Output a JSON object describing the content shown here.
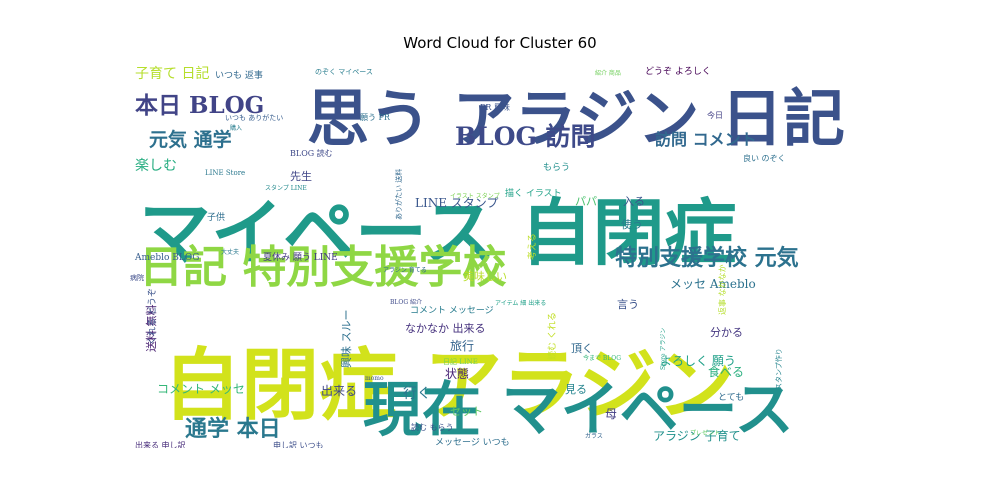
{
  "chart_data": {
    "type": "wordcloud",
    "title": "Word Cloud for Cluster 60",
    "words": [
      {
        "text": "自閉症 アラジン",
        "weight": 100,
        "color": "#d2e21b",
        "rot": 0
      },
      {
        "text": "マイペース 自閉症",
        "weight": 92,
        "color": "#1f9a8a",
        "rot": 0
      },
      {
        "text": "思う アラジン 日記",
        "weight": 80,
        "color": "#3b528b",
        "rot": 0
      },
      {
        "text": "現在 マイペース",
        "weight": 76,
        "color": "#21908d",
        "rot": 0
      },
      {
        "text": "日記 特別支援学校",
        "weight": 56,
        "color": "#8fd744",
        "rot": 0
      },
      {
        "text": "BLOG 訪問",
        "weight": 32,
        "color": "#3e4a89",
        "rot": 0
      },
      {
        "text": "本日 BLOG",
        "weight": 30,
        "color": "#414487",
        "rot": 0
      },
      {
        "text": "特別支援学校 元気",
        "weight": 28,
        "color": "#2c728e",
        "rot": 0
      },
      {
        "text": "通学 本日",
        "weight": 28,
        "color": "#2a788e",
        "rot": 0
      },
      {
        "text": "元気 通学",
        "weight": 24,
        "color": "#2d708e",
        "rot": 0
      },
      {
        "text": "訪問 コメント",
        "weight": 20,
        "color": "#31688e",
        "rot": 0
      },
      {
        "text": "子育て 日記",
        "weight": 18,
        "color": "#b5de2b",
        "rot": 0
      },
      {
        "text": "楽しむ",
        "weight": 18,
        "color": "#27ad81",
        "rot": 0
      },
      {
        "text": "LINE スタンプ",
        "weight": 16,
        "color": "#39568c",
        "rot": 0
      },
      {
        "text": "メッセ Ameblo",
        "weight": 16,
        "color": "#2c728e",
        "rot": 0
      },
      {
        "text": "なかなか 出来る",
        "weight": 14,
        "color": "#46327e",
        "rot": 0
      },
      {
        "text": "コメント メッセ",
        "weight": 16,
        "color": "#35b779",
        "rot": 0
      },
      {
        "text": "アラジン 子育て",
        "weight": 16,
        "color": "#21918c",
        "rot": 0
      },
      {
        "text": "よろしく 願う",
        "weight": 16,
        "color": "#1fa088",
        "rot": 0
      },
      {
        "text": "出来る",
        "weight": 16,
        "color": "#3f4788",
        "rot": 0
      },
      {
        "text": "旅行",
        "weight": 16,
        "color": "#33638d",
        "rot": 0
      },
      {
        "text": "状態",
        "weight": 16,
        "color": "#482576",
        "rot": 0
      },
      {
        "text": "食べる",
        "weight": 16,
        "color": "#29af7f",
        "rot": 0
      },
      {
        "text": "行く",
        "weight": 18,
        "color": "#2a768e",
        "rot": 0
      },
      {
        "text": "見る",
        "weight": 14,
        "color": "#25848e",
        "rot": 0
      },
      {
        "text": "母",
        "weight": 16,
        "color": "#433e85",
        "rot": 0
      },
      {
        "text": "頂く",
        "weight": 14,
        "color": "#31688e",
        "rot": 0
      },
      {
        "text": "分かる",
        "weight": 14,
        "color": "#453781",
        "rot": 0
      },
      {
        "text": "言う",
        "weight": 14,
        "color": "#3b528b",
        "rot": 0
      },
      {
        "text": "使う",
        "weight": 14,
        "color": "#287d8e",
        "rot": 0
      },
      {
        "text": "入る",
        "weight": 14,
        "color": "#3a548c",
        "rot": 0
      },
      {
        "text": "パパ",
        "weight": 14,
        "color": "#4ac16d",
        "rot": 0
      },
      {
        "text": "先生",
        "weight": 14,
        "color": "#404688",
        "rot": 0
      },
      {
        "text": "子供",
        "weight": 12,
        "color": "#2e6e8e",
        "rot": 0
      },
      {
        "text": "美味しい",
        "weight": 14,
        "color": "#b8de29",
        "rot": 0
      },
      {
        "text": "夏休み 願う LINE",
        "weight": 11,
        "color": "#443983",
        "rot": 0
      },
      {
        "text": "Ameblo BLOG",
        "weight": 12,
        "color": "#365d8d",
        "rot": 0
      },
      {
        "text": "メッセージ いつも",
        "weight": 11,
        "color": "#2e6f8e",
        "rot": 0
      },
      {
        "text": "コメント メッセージ",
        "weight": 11,
        "color": "#287c8e",
        "rot": 0
      },
      {
        "text": "セット",
        "weight": 14,
        "color": "#5ec962",
        "rot": 0
      },
      {
        "text": "とても",
        "weight": 11,
        "color": "#2f6b8e",
        "rot": 0
      },
      {
        "text": "いつも 返事",
        "weight": 11,
        "color": "#31688e",
        "rot": 0
      },
      {
        "text": "のぞく マイペース",
        "weight": 9,
        "color": "#287d8e",
        "rot": 0
      },
      {
        "text": "どうぞ よろしく",
        "weight": 11,
        "color": "#440154",
        "rot": 0
      },
      {
        "text": "PR 興味",
        "weight": 10,
        "color": "#3b528b",
        "rot": 0
      },
      {
        "text": "描く イラスト",
        "weight": 11,
        "color": "#1fa187",
        "rot": 0
      },
      {
        "text": "BLOG 読む",
        "weight": 10,
        "color": "#3e4989",
        "rot": 0
      },
      {
        "text": "LINE Store",
        "weight": 9,
        "color": "#2a788e",
        "rot": 0
      },
      {
        "text": "今日",
        "weight": 10,
        "color": "#424086",
        "rot": 0
      },
      {
        "text": "良い のぞく",
        "weight": 10,
        "color": "#2d708e",
        "rot": 0
      },
      {
        "text": "もらう",
        "weight": 12,
        "color": "#218f8d",
        "rot": 0
      },
      {
        "text": "日記 LINE",
        "weight": 9,
        "color": "#75d054",
        "rot": 0
      },
      {
        "text": "読む もらう",
        "weight": 10,
        "color": "#3b528b",
        "rot": 0
      },
      {
        "text": "出来る 申し訳",
        "weight": 10,
        "color": "#472c7a",
        "rot": 0
      },
      {
        "text": "申し訳 いつも",
        "weight": 10,
        "color": "#3d4e8a",
        "rot": 0
      },
      {
        "text": "病院",
        "weight": 9,
        "color": "#3e4c8a",
        "rot": 0
      },
      {
        "text": "いつも ありがたい",
        "weight": 9,
        "color": "#365c8d",
        "rot": 0
      },
      {
        "text": "願う PR",
        "weight": 10,
        "color": "#2d708e",
        "rot": 0
      },
      {
        "text": "スタンプ LINE",
        "weight": 8,
        "color": "#238a8d",
        "rot": 0
      },
      {
        "text": "興味 スルー",
        "weight": 14,
        "color": "#2d708e",
        "rot": 270
      },
      {
        "text": "送料 無料",
        "weight": 14,
        "color": "#482071",
        "rot": 270
      },
      {
        "text": "くれる どうぞ",
        "weight": 11,
        "color": "#3b528b",
        "rot": 270
      },
      {
        "text": "読む くれる",
        "weight": 11,
        "color": "#c2df23",
        "rot": 270
      },
      {
        "text": "考える",
        "weight": 11,
        "color": "#bddf26",
        "rot": 270
      },
      {
        "text": "返事 なかなか",
        "weight": 10,
        "color": "#b5de2b",
        "rot": 270
      },
      {
        "text": "スタンプ作り",
        "weight": 9,
        "color": "#25848e",
        "rot": 270
      },
      {
        "text": "ありがたい 送料",
        "weight": 9,
        "color": "#31688e",
        "rot": 270
      },
      {
        "text": "Store アラジン",
        "weight": 8,
        "color": "#1f9f88",
        "rot": 270
      },
      {
        "text": "momo",
        "weight": 7,
        "color": "#3b528b",
        "rot": 0
      },
      {
        "text": "アラジン 育てる",
        "weight": 7,
        "color": "#31688e",
        "rot": 0
      },
      {
        "text": "イラスト スタンプ",
        "weight": 6,
        "color": "#7ad151",
        "rot": 0
      },
      {
        "text": "アイテム 細 出来る",
        "weight": 6,
        "color": "#1fa088",
        "rot": 0
      },
      {
        "text": "BLOG 紹介",
        "weight": 6,
        "color": "#3e4a89",
        "rot": 0
      },
      {
        "text": "今まで BLOG",
        "weight": 6,
        "color": "#35b779",
        "rot": 0
      },
      {
        "text": "購入",
        "weight": 6,
        "color": "#287d8e",
        "rot": 0
      },
      {
        "text": "紹介 商品",
        "weight": 6,
        "color": "#6ece58",
        "rot": 0
      },
      {
        "text": "ガラス",
        "weight": 6,
        "color": "#33638d",
        "rot": 0
      },
      {
        "text": "プレゼント",
        "weight": 6,
        "color": "#5ec962",
        "rot": 0
      },
      {
        "text": "大丈夫",
        "weight": 6,
        "color": "#2a788e",
        "rot": 0
      }
    ]
  }
}
